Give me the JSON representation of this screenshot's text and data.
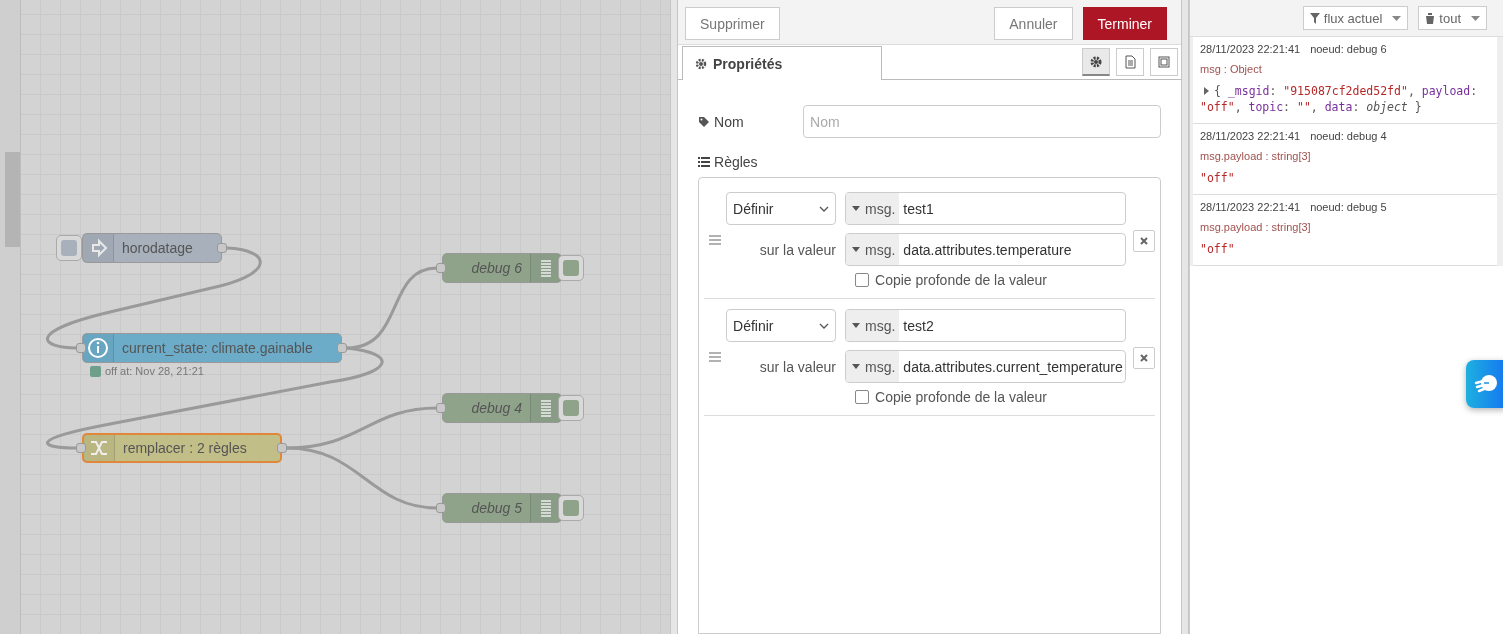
{
  "flow": {
    "nodes": [
      {
        "kind": "inject",
        "label": "horodatage",
        "selected": false
      },
      {
        "kind": "api",
        "label": "current_state: climate.gainable",
        "selected": false,
        "status": {
          "text": "off at: Nov 28, 21:21",
          "color": "#6e9e8c"
        }
      },
      {
        "kind": "change",
        "label": "remplacer : 2 règles",
        "selected": true
      },
      {
        "kind": "debug",
        "label": "debug 6",
        "selected": false
      },
      {
        "kind": "debug",
        "label": "debug 4",
        "selected": false
      },
      {
        "kind": "debug",
        "label": "debug 5",
        "selected": false
      }
    ]
  },
  "editor": {
    "buttons": [
      {
        "kind": "delete",
        "label": "Supprimer"
      },
      {
        "kind": "cancel",
        "label": "Annuler"
      },
      {
        "kind": "done",
        "label": "Terminer"
      }
    ],
    "tabs": [
      {
        "label": "Propriétés",
        "selected": true
      }
    ],
    "tab_icons": [
      {
        "kind": "settings",
        "selected": true
      },
      {
        "kind": "description",
        "selected": false
      },
      {
        "kind": "appearance",
        "selected": false
      }
    ],
    "name_field": {
      "label": "Nom",
      "placeholder": "Nom"
    },
    "rules_label": "Règles",
    "rules": [
      {
        "action": "Définir",
        "target_prefix": "msg.",
        "target": "test1",
        "source_label": "sur la valeur",
        "source_prefix": "msg.",
        "source": "data.attributes.temperature",
        "deep_copy": {
          "label": "Copie profonde de la valeur",
          "checked": false
        }
      },
      {
        "action": "Définir",
        "target_prefix": "msg.",
        "target": "test2",
        "source_label": "sur la valeur",
        "source_prefix": "msg.",
        "source": "data.attributes.current_temperature",
        "deep_copy": {
          "label": "Copie profonde de la valeur",
          "checked": false
        }
      }
    ]
  },
  "debug": {
    "filters": [
      {
        "kind": "filter",
        "label": "flux actuel"
      },
      {
        "kind": "clear",
        "label": "tout"
      }
    ],
    "messages": [
      {
        "time": "28/11/2023 22:21:41",
        "node": "noeud: debug 6",
        "type": "msg : Object",
        "expandable": true,
        "lines": [
          [
            {
              "kind": "punct",
              "text": "{ "
            },
            {
              "kind": "key",
              "text": "_msgid"
            },
            {
              "kind": "punct",
              "text": ": "
            },
            {
              "kind": "string",
              "text": "\"915087cf2ded52fd\""
            },
            {
              "kind": "punct",
              "text": ", "
            },
            {
              "kind": "key",
              "text": "payload"
            },
            {
              "kind": "punct",
              "text": ":"
            }
          ],
          [
            {
              "kind": "string",
              "text": "\"off\""
            },
            {
              "kind": "punct",
              "text": ", "
            },
            {
              "kind": "key",
              "text": "topic"
            },
            {
              "kind": "punct",
              "text": ": "
            },
            {
              "kind": "string",
              "text": "\"\""
            },
            {
              "kind": "punct",
              "text": ", "
            },
            {
              "kind": "key",
              "text": "data"
            },
            {
              "kind": "punct",
              "text": ": "
            },
            {
              "kind": "type",
              "text": "object"
            },
            {
              "kind": "punct",
              "text": " }"
            }
          ]
        ]
      },
      {
        "time": "28/11/2023 22:21:41",
        "node": "noeud: debug 4",
        "type": "msg.payload : string[3]",
        "expandable": false,
        "lines": [
          [
            {
              "kind": "string",
              "text": "\"off\""
            }
          ]
        ]
      },
      {
        "time": "28/11/2023 22:21:41",
        "node": "noeud: debug 5",
        "type": "msg.payload : string[3]",
        "expandable": false,
        "lines": [
          [
            {
              "kind": "string",
              "text": "\"off\""
            }
          ]
        ]
      }
    ]
  }
}
